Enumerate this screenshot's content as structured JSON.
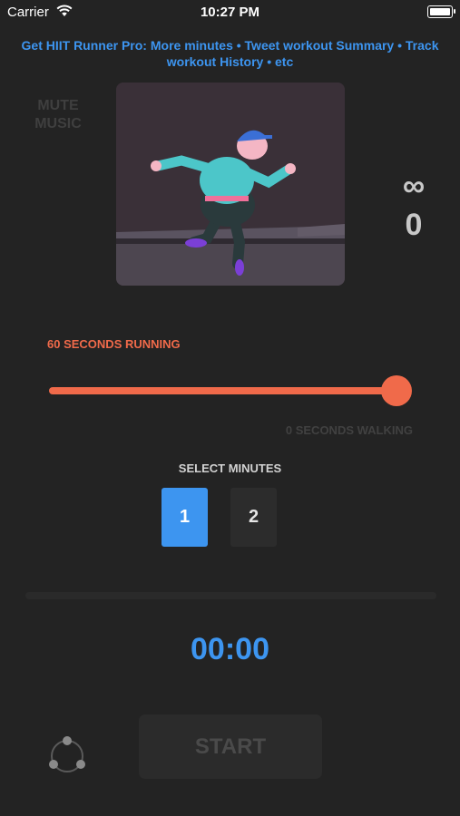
{
  "status_bar": {
    "carrier": "Carrier",
    "time": "10:27 PM",
    "icons": [
      "wifi-icon",
      "battery-icon"
    ]
  },
  "promo": {
    "text": "Get HIIT Runner Pro: More minutes • Tweet workout Summary • Track workout History • etc"
  },
  "mute_music": "MUTE MUSIC",
  "artwork": {
    "icon": "runner-illustration"
  },
  "stats": {
    "infinity": "∞",
    "count": "0"
  },
  "interval": {
    "running_label": "60 SECONDS RUNNING",
    "walking_label": "0 SECONDS WALKING",
    "slider_fraction": 1.0
  },
  "select_minutes": {
    "label": "SELECT MINUTES",
    "options": [
      "1",
      "2"
    ],
    "selected": "1"
  },
  "progress": {
    "fraction": 0
  },
  "timer": "00:00",
  "start_button": "START",
  "share": {
    "icon": "share-icon"
  },
  "colors": {
    "background": "#232323",
    "accent_blue": "#3d95f0",
    "accent_orange": "#f06a4a",
    "disabled": "#2b2b2b"
  }
}
